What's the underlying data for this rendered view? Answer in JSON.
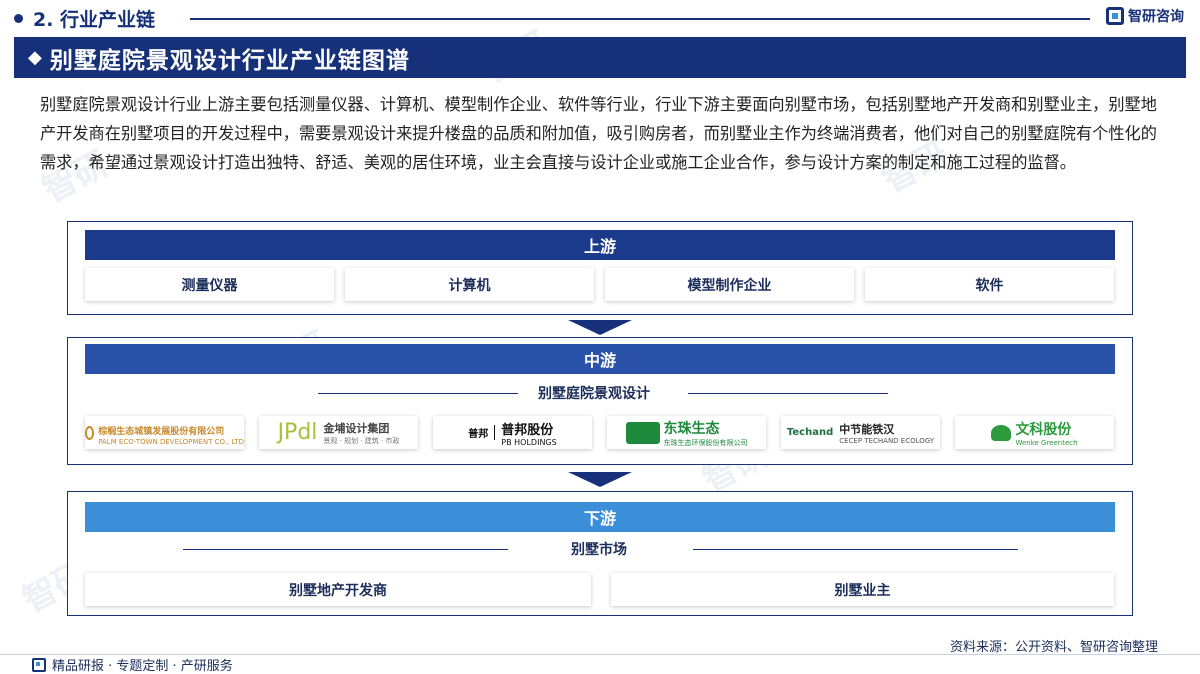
{
  "header": {
    "section": "2. 行业产业链",
    "brand": "智研咨询",
    "title": "别墅庭院景观设计行业产业链图谱"
  },
  "intro": "别墅庭院景观设计行业上游主要包括测量仪器、计算机、模型制作企业、软件等行业，行业下游主要面向别墅市场，包括别墅地产开发商和别墅业主，别墅地产开发商在别墅项目的开发过程中，需要景观设计来提升楼盘的品质和附加值，吸引购房者，而别墅业主作为终端消费者，他们对自己的别墅庭院有个性化的需求，希望通过景观设计打造出独特、舒适、美观的居住环境，业主会直接与设计企业或施工企业合作，参与设计方案的制定和施工过程的监督。",
  "upstream": {
    "label": "上游",
    "items": [
      "测量仪器",
      "计算机",
      "模型制作企业",
      "软件"
    ]
  },
  "midstream": {
    "label": "中游",
    "subtitle": "别墅庭院景观设计",
    "companies": [
      {
        "name": "棕榈生态城镇发展股份有限公司",
        "sub": "PALM ECO-TOWN DEVELOPMENT CO., LTD",
        "color": "#c8892b"
      },
      {
        "name": "JPdl",
        "name2": "金埔设计集团",
        "sub": "景观 · 规划 · 建筑 · 市政",
        "color": "#a7c23a"
      },
      {
        "name": "普邦股份",
        "sub": "PB HOLDINGS",
        "mark": "普邦",
        "color": "#111111"
      },
      {
        "name": "东珠生态",
        "sub": "东珠生态环保股份有限公司",
        "color": "#1e8a3c"
      },
      {
        "name": "中节能铁汉",
        "mark": "Techand",
        "sub": "CECEP TECHAND ECOLOGY",
        "color": "#1d6e45"
      },
      {
        "name": "文科股份",
        "sub": "Wenke Greentech",
        "color": "#2c9a3d"
      }
    ]
  },
  "downstream": {
    "label": "下游",
    "subtitle": "别墅市场",
    "items": [
      "别墅地产开发商",
      "别墅业主"
    ]
  },
  "source": "资料来源：公开资料、智研咨询整理",
  "footer": "精品研报 · 专题定制 · 产研服务",
  "watermark": "智研",
  "colors": {
    "navy": "#16307a",
    "upstream_head": "#1b3a8c",
    "midstream_head": "#2a52a8",
    "downstream_head": "#3a8fd8"
  }
}
